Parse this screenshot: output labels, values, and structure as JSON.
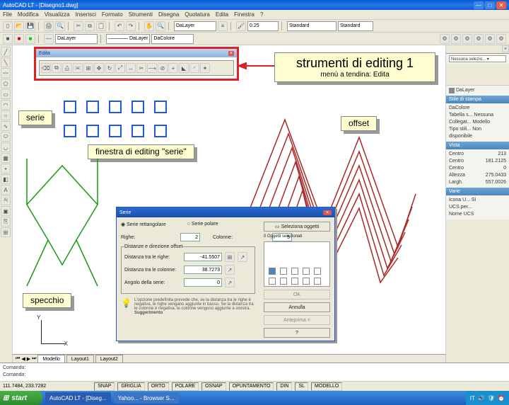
{
  "app": {
    "title": "AutoCAD LT - [Disegno1.dwg]"
  },
  "menubar": [
    "File",
    "Modifica",
    "Visualizza",
    "Inserisci",
    "Formato",
    "Strumenti",
    "Disegna",
    "Quotatura",
    "Edita",
    "Finestra",
    "?"
  ],
  "toolbars": {
    "layer_dropdown": "DaLayer",
    "linetype_dropdown": "DaLayer",
    "color_dropdown": "DaColore",
    "edita_title": "Edita"
  },
  "callouts": {
    "main_title": "strumenti di editing 1",
    "main_sub": "menù a tendina: Edita",
    "serie": "serie",
    "offset": "offset",
    "serie_dialog": "finestra di editing \"serie\"",
    "specchio": "specchio"
  },
  "right_panel": {
    "properties_head": "",
    "layer_line1": "DaLayer",
    "style_head": "Stile di stampa",
    "style_lines": [
      "DaColore",
      "Tabella s... Nessuna",
      "Collegat... Modello",
      "Tipo stili... Non disponibile"
    ],
    "view_head": "Vista",
    "view_lines": [
      [
        "Centro",
        "213"
      ],
      [
        "Centro",
        "181.2125"
      ],
      [
        "Centro",
        "0"
      ],
      [
        "Altezza",
        "275.0433"
      ],
      [
        "Largh.",
        "557.0026"
      ]
    ],
    "misc_head": "Varie",
    "misc_lines": [
      "Icona U... Sì",
      "UCS per...",
      "Nome UCS"
    ]
  },
  "dialog": {
    "title": "Serie",
    "radio_rect": "Serie rettangolare",
    "radio_polar": "Serie polare",
    "rows_label": "Righe:",
    "rows_value": "2",
    "cols_label": "Colonne:",
    "cols_value": "5",
    "group_title": "Distanze e direzione offset",
    "row_dist_label": "Distanza tra le righe:",
    "row_dist_value": "-41.5507",
    "col_dist_label": "Distanza tra le colonne:",
    "col_dist_value": "38.7273",
    "angle_label": "Angolo della serie:",
    "angle_value": "0",
    "tip_text": "L'opzione predefinita prevede che, se la distanza tra le righe è negativa, le righe vengano aggiunte in basso. Se la distanza tra le colonne è negativa, le colonne vengono aggiunte a sinistra.",
    "tip_label": "Suggerimento",
    "sel_btn": "Seleziona oggetti",
    "sel_count": "0 Oggetti selezionati",
    "ok": "OK",
    "cancel": "Annulla",
    "preview": "Anteprima <",
    "help": "?"
  },
  "ucs": {
    "y": "Y",
    "x": "X"
  },
  "tabs": [
    "Modello",
    "Layout1",
    "Layout2"
  ],
  "cmdline": {
    "line1": "Comando:",
    "line2": "Comando:"
  },
  "status": {
    "coords": "111.7484, 233.7282",
    "toggles": [
      "SNAP",
      "GRIGLIA",
      "ORTO",
      "POLARE",
      "OSNAP",
      "OPUNTAMENTO",
      "DIN",
      "SL",
      "MODELLO"
    ]
  },
  "taskbar": {
    "start": "start",
    "items": [
      "AutoCAD LT - [Diseg...",
      "Yahoo... - Browser S..."
    ],
    "tray_lang": "IT"
  }
}
